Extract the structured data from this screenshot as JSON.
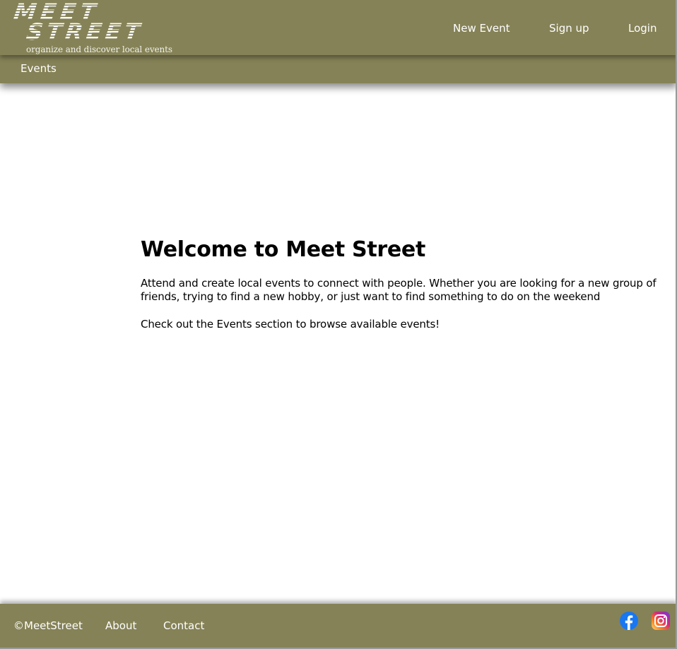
{
  "brand": {
    "logo_line1": "MEET",
    "logo_line2": "STREET",
    "tagline": "organize and discover local events"
  },
  "header": {
    "nav": {
      "new_event": "New Event",
      "sign_up": "Sign up",
      "login": "Login"
    },
    "subnav": {
      "events": "Events"
    }
  },
  "main": {
    "title": "Welcome to Meet Street",
    "intro": "Attend and create local events to connect with people. Whether you are looking for a new group of friends, trying to find a new hobby, or just want to find something to do on the weekend",
    "cta": "Check out the Events section to browse available events!"
  },
  "footer": {
    "copyright": "©MeetStreet",
    "about": "About",
    "contact": "Contact",
    "social": [
      "facebook-icon",
      "instagram-icon"
    ]
  },
  "colors": {
    "bar": "#858257",
    "text_on_bar": "#ffffff",
    "facebook": "#1877f2"
  }
}
